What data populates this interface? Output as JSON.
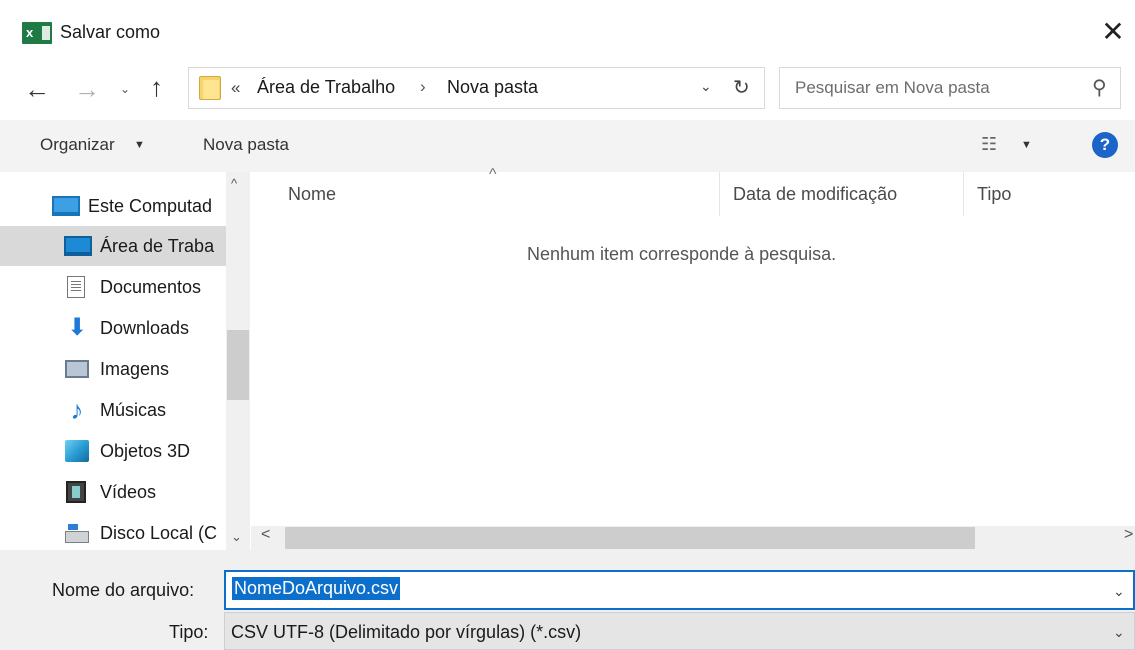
{
  "window": {
    "app_icon_letter": "x",
    "title": "Salvar como",
    "close_glyph": "✕"
  },
  "nav": {
    "back_glyph": "←",
    "forward_glyph": "→",
    "recent_glyph": "⌄",
    "up_glyph": "↑"
  },
  "address": {
    "overflow_glyph": "«",
    "crumbs": [
      "Área de Trabalho",
      "Nova pasta"
    ],
    "separator": "›",
    "dropdown_glyph": "⌄",
    "refresh_glyph": "↻"
  },
  "search": {
    "placeholder": "Pesquisar em Nova pasta",
    "icon": "search-icon",
    "icon_glyph": "⚲"
  },
  "toolbar": {
    "organize_label": "Organizar",
    "organize_caret": "▼",
    "new_folder_label": "Nova pasta",
    "view_glyph": "☷",
    "view_caret": "▼",
    "help_glyph": "?"
  },
  "sidebar": {
    "items": [
      {
        "label": "Este Computad",
        "icon": "computer-icon"
      },
      {
        "label": "Área de Traba",
        "icon": "desktop-icon",
        "selected": true
      },
      {
        "label": "Documentos",
        "icon": "documents-icon"
      },
      {
        "label": "Downloads",
        "icon": "downloads-icon",
        "glyph": "⬇"
      },
      {
        "label": "Imagens",
        "icon": "pictures-icon"
      },
      {
        "label": "Músicas",
        "icon": "music-icon",
        "glyph": "♪"
      },
      {
        "label": "Objetos 3D",
        "icon": "3d-objects-icon"
      },
      {
        "label": "Vídeos",
        "icon": "videos-icon"
      },
      {
        "label": "Disco Local (C",
        "icon": "local-disk-icon"
      }
    ],
    "scroll_up_glyph": "^",
    "scroll_down_glyph": "⌄"
  },
  "file_list": {
    "sort_glyph": "^",
    "columns": [
      "Nome",
      "Data de modificação",
      "Tipo"
    ],
    "empty_message": "Nenhum item corresponde à pesquisa.",
    "scroll_left_glyph": "<",
    "scroll_right_glyph": ">"
  },
  "form": {
    "filename_label": "Nome do arquivo:",
    "filename_value": "NomeDoArquivo.csv",
    "type_label": "Tipo:",
    "type_value": "CSV UTF-8 (Delimitado por vírgulas) (*.csv)",
    "dropdown_glyph": "⌄"
  },
  "colors": {
    "accent": "#0b6fcb",
    "excel_green": "#1f7a45",
    "help_blue": "#1c64c8"
  }
}
